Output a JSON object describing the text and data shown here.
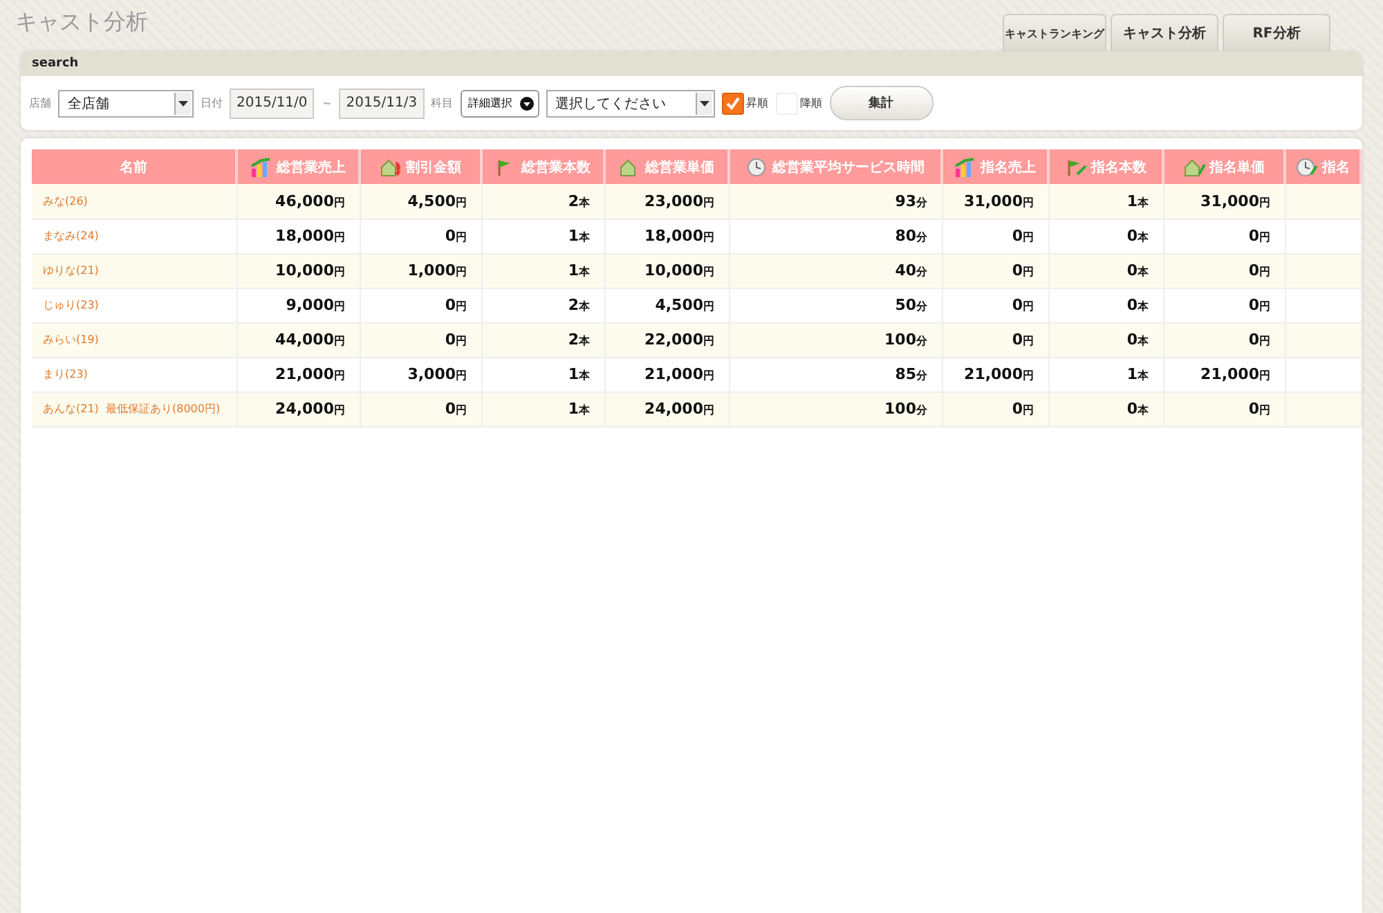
{
  "page_title": "キャスト分析",
  "tabs": [
    {
      "label": "キャストランキング"
    },
    {
      "label": "キャスト分析"
    },
    {
      "label": "RF分析"
    }
  ],
  "search": {
    "title": "search",
    "store_label": "店舗",
    "store_value": "全店舗",
    "date_label": "日付",
    "date_from": "2015/11/0",
    "date_separator": "～",
    "date_to": "2015/11/3",
    "subject_label": "科目",
    "detail_select": "詳細選択",
    "subject_value": "選択してください",
    "sort_options": [
      {
        "label": "昇順",
        "checked": true
      },
      {
        "label": "降順",
        "checked": false
      }
    ],
    "submit": "集計"
  },
  "table": {
    "columns": [
      "名前",
      "総営業売上",
      "割引金額",
      "総営業本数",
      "総営業単価",
      "総営業平均サービス時間",
      "指名売上",
      "指名本数",
      "指名単価",
      "指名"
    ],
    "rows": [
      {
        "cells": [
          {
            "kind": "name",
            "value": "みな(26)"
          },
          {
            "kind": "num",
            "value": "46,000",
            "unit": "円"
          },
          {
            "kind": "num",
            "value": "4,500",
            "unit": "円"
          },
          {
            "kind": "num",
            "value": "2",
            "unit": "本"
          },
          {
            "kind": "num",
            "value": "23,000",
            "unit": "円"
          },
          {
            "kind": "num",
            "value": "93",
            "unit": "分"
          },
          {
            "kind": "num",
            "value": "31,000",
            "unit": "円"
          },
          {
            "kind": "num",
            "value": "1",
            "unit": "本"
          },
          {
            "kind": "num",
            "value": "31,000",
            "unit": "円"
          }
        ]
      },
      {
        "cells": [
          {
            "kind": "name",
            "value": "まなみ(24)"
          },
          {
            "kind": "num",
            "value": "18,000",
            "unit": "円"
          },
          {
            "kind": "num",
            "value": "0",
            "unit": "円"
          },
          {
            "kind": "num",
            "value": "1",
            "unit": "本"
          },
          {
            "kind": "num",
            "value": "18,000",
            "unit": "円"
          },
          {
            "kind": "num",
            "value": "80",
            "unit": "分"
          },
          {
            "kind": "num",
            "value": "0",
            "unit": "円"
          },
          {
            "kind": "num",
            "value": "0",
            "unit": "本"
          },
          {
            "kind": "num",
            "value": "0",
            "unit": "円"
          }
        ]
      },
      {
        "cells": [
          {
            "kind": "name",
            "value": "ゆりな(21)"
          },
          {
            "kind": "num",
            "value": "10,000",
            "unit": "円"
          },
          {
            "kind": "num",
            "value": "1,000",
            "unit": "円"
          },
          {
            "kind": "num",
            "value": "1",
            "unit": "本"
          },
          {
            "kind": "num",
            "value": "10,000",
            "unit": "円"
          },
          {
            "kind": "num",
            "value": "40",
            "unit": "分"
          },
          {
            "kind": "num",
            "value": "0",
            "unit": "円"
          },
          {
            "kind": "num",
            "value": "0",
            "unit": "本"
          },
          {
            "kind": "num",
            "value": "0",
            "unit": "円"
          }
        ]
      },
      {
        "cells": [
          {
            "kind": "name",
            "value": "じゅり(23)"
          },
          {
            "kind": "num",
            "value": "9,000",
            "unit": "円"
          },
          {
            "kind": "num",
            "value": "0",
            "unit": "円"
          },
          {
            "kind": "num",
            "value": "2",
            "unit": "本"
          },
          {
            "kind": "num",
            "value": "4,500",
            "unit": "円"
          },
          {
            "kind": "num",
            "value": "50",
            "unit": "分"
          },
          {
            "kind": "num",
            "value": "0",
            "unit": "円"
          },
          {
            "kind": "num",
            "value": "0",
            "unit": "本"
          },
          {
            "kind": "num",
            "value": "0",
            "unit": "円"
          }
        ]
      },
      {
        "cells": [
          {
            "kind": "name",
            "value": "みらい(19)"
          },
          {
            "kind": "num",
            "value": "44,000",
            "unit": "円"
          },
          {
            "kind": "num",
            "value": "0",
            "unit": "円"
          },
          {
            "kind": "num",
            "value": "2",
            "unit": "本"
          },
          {
            "kind": "num",
            "value": "22,000",
            "unit": "円"
          },
          {
            "kind": "num",
            "value": "100",
            "unit": "分"
          },
          {
            "kind": "num",
            "value": "0",
            "unit": "円"
          },
          {
            "kind": "num",
            "value": "0",
            "unit": "本"
          },
          {
            "kind": "num",
            "value": "0",
            "unit": "円"
          }
        ]
      },
      {
        "cells": [
          {
            "kind": "name",
            "value": "まり(23)"
          },
          {
            "kind": "num",
            "value": "21,000",
            "unit": "円"
          },
          {
            "kind": "num",
            "value": "3,000",
            "unit": "円"
          },
          {
            "kind": "num",
            "value": "1",
            "unit": "本"
          },
          {
            "kind": "num",
            "value": "21,000",
            "unit": "円"
          },
          {
            "kind": "num",
            "value": "85",
            "unit": "分"
          },
          {
            "kind": "num",
            "value": "21,000",
            "unit": "円"
          },
          {
            "kind": "num",
            "value": "1",
            "unit": "本"
          },
          {
            "kind": "num",
            "value": "21,000",
            "unit": "円"
          }
        ]
      },
      {
        "cells": [
          {
            "kind": "name",
            "value": "あんな(21)  最低保証あり(8000円)"
          },
          {
            "kind": "num",
            "value": "24,000",
            "unit": "円"
          },
          {
            "kind": "num",
            "value": "0",
            "unit": "円"
          },
          {
            "kind": "num",
            "value": "1",
            "unit": "本"
          },
          {
            "kind": "num",
            "value": "24,000",
            "unit": "円"
          },
          {
            "kind": "num",
            "value": "100",
            "unit": "分"
          },
          {
            "kind": "num",
            "value": "0",
            "unit": "円"
          },
          {
            "kind": "num",
            "value": "0",
            "unit": "本"
          },
          {
            "kind": "num",
            "value": "0",
            "unit": "円"
          }
        ]
      }
    ]
  }
}
